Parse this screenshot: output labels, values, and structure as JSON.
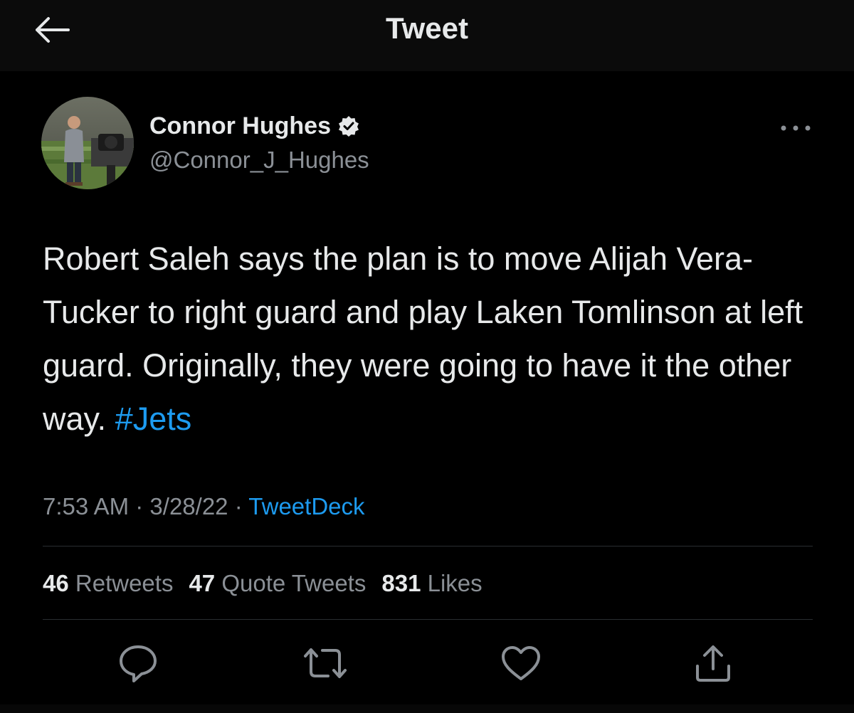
{
  "header": {
    "title": "Tweet",
    "back_icon": "arrow-left-icon"
  },
  "author": {
    "name": "Connor Hughes",
    "handle": "@Connor_J_Hughes",
    "verified": true,
    "verified_icon": "verified-badge-icon"
  },
  "tweet": {
    "text": "Robert Saleh says the plan is to move Alijah Vera-Tucker to right guard and play Laken Tomlinson at left guard. Originally, they were going to have it the other way. ",
    "hashtag": "#Jets",
    "time": "7:53 AM",
    "date": "3/28/22",
    "separator": "·",
    "source": "TweetDeck"
  },
  "stats": {
    "retweets_count": "46",
    "retweets_label": "Retweets",
    "quotes_count": "47",
    "quotes_label": "Quote Tweets",
    "likes_count": "831",
    "likes_label": "Likes"
  },
  "actions": [
    "reply-icon",
    "retweet-icon",
    "like-icon",
    "share-icon"
  ],
  "colors": {
    "background": "#000000",
    "text_primary": "#e7e9ea",
    "text_secondary": "#8b9096",
    "accent": "#1d9bf0",
    "divider": "#2a2d31"
  }
}
